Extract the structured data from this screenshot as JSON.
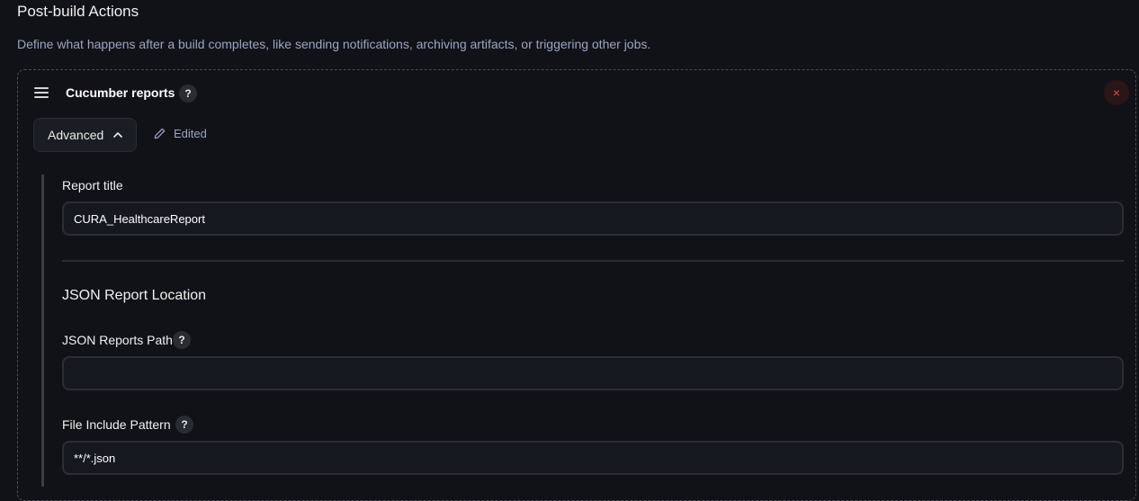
{
  "section": {
    "title": "Post-build Actions",
    "description": "Define what happens after a build completes, like sending notifications, archiving artifacts, or triggering other jobs."
  },
  "step": {
    "title": "Cucumber reports",
    "help_glyph": "?",
    "close_glyph": "×",
    "advanced_label": "Advanced",
    "edited_label": "Edited"
  },
  "fields": {
    "report_title": {
      "label": "Report title",
      "value": "CURA_HealthcareReport"
    },
    "json_location_heading": "JSON Report Location",
    "json_reports_path": {
      "label": "JSON Reports Path",
      "value": ""
    },
    "file_include_pattern": {
      "label": "File Include Pattern",
      "value": "**/*.json"
    }
  },
  "colors": {
    "background": "#111217",
    "accent_text": "#9ba4c4",
    "danger": "#e5484d"
  }
}
